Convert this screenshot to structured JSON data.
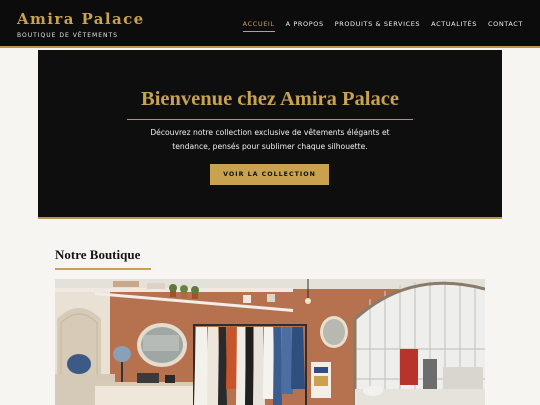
{
  "header": {
    "brand": "Amira Palace",
    "tagline": "BOUTIQUE DE VÊTEMENTS",
    "nav": [
      {
        "label": "ACCUEIL",
        "active": true
      },
      {
        "label": "A PROPOS",
        "active": false
      },
      {
        "label": "PRODUITS & SERVICES",
        "active": false
      },
      {
        "label": "ACTUALITÉS",
        "active": false
      },
      {
        "label": "CONTACT",
        "active": false
      }
    ]
  },
  "hero": {
    "title": "Bienvenue chez Amira Palace",
    "description": "Découvrez notre collection exclusive de vêtements élégants et tendance, pensés pour sublimer chaque silhouette.",
    "cta_label": "VOIR LA COLLECTION"
  },
  "boutique": {
    "title": "Notre Boutique",
    "image_icon": "boutique-interior-photo"
  },
  "colors": {
    "gold": "#c9a24f",
    "black": "#0c0c0c",
    "background": "#f7f5f1"
  }
}
